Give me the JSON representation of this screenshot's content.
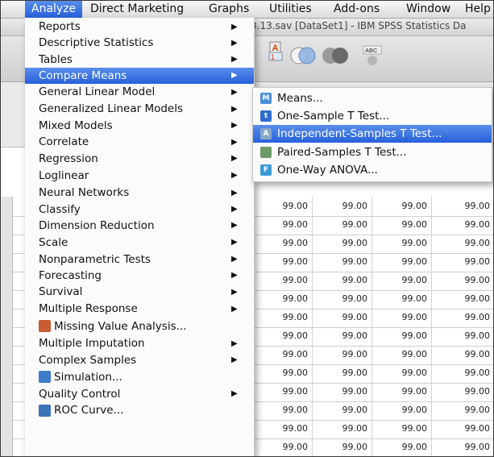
{
  "menubar": {
    "items": [
      "Analyze",
      "Direct Marketing",
      "Graphs",
      "Utilities",
      "Add-ons",
      "Window",
      "Help"
    ],
    "active": "Analyze"
  },
  "window": {
    "title": "3.13.sav [DataSet1] - IBM SPSS Statistics Da"
  },
  "analyze_menu": {
    "items": [
      {
        "label": "Reports",
        "has_submenu": true
      },
      {
        "label": "Descriptive Statistics",
        "has_submenu": true
      },
      {
        "label": "Tables",
        "has_submenu": true
      },
      {
        "label": "Compare Means",
        "has_submenu": true,
        "active": true
      },
      {
        "label": "General Linear Model",
        "has_submenu": true
      },
      {
        "label": "Generalized Linear Models",
        "has_submenu": true
      },
      {
        "label": "Mixed Models",
        "has_submenu": true
      },
      {
        "label": "Correlate",
        "has_submenu": true
      },
      {
        "label": "Regression",
        "has_submenu": true
      },
      {
        "label": "Loglinear",
        "has_submenu": true
      },
      {
        "label": "Neural Networks",
        "has_submenu": true
      },
      {
        "label": "Classify",
        "has_submenu": true
      },
      {
        "label": "Dimension Reduction",
        "has_submenu": true
      },
      {
        "label": "Scale",
        "has_submenu": true
      },
      {
        "label": "Nonparametric Tests",
        "has_submenu": true
      },
      {
        "label": "Forecasting",
        "has_submenu": true
      },
      {
        "label": "Survival",
        "has_submenu": true
      },
      {
        "label": "Multiple Response",
        "has_submenu": true
      },
      {
        "label": "Missing Value Analysis...",
        "icon": "missing-value-icon"
      },
      {
        "label": "Multiple Imputation",
        "has_submenu": true
      },
      {
        "label": "Complex Samples",
        "has_submenu": true
      },
      {
        "label": "Simulation...",
        "icon": "simulation-icon"
      },
      {
        "label": "Quality Control",
        "has_submenu": true
      },
      {
        "label": "ROC Curve...",
        "icon": "roc-curve-icon"
      }
    ],
    "arrow_glyph": "▶"
  },
  "compare_means_submenu": {
    "items": [
      {
        "label": "Means...",
        "icon": "means-icon",
        "glyph": "M",
        "color": "#4a90d9"
      },
      {
        "label": "One-Sample T Test...",
        "icon": "one-sample-t-icon",
        "glyph": "t",
        "color": "#2f6fcf"
      },
      {
        "label": "Independent-Samples T Test...",
        "icon": "independent-t-icon",
        "glyph": "A",
        "color": "#8aa8c8",
        "active": true
      },
      {
        "label": "Paired-Samples T Test...",
        "icon": "paired-t-icon",
        "glyph": "",
        "color": "#6c9a6a"
      },
      {
        "label": "One-Way ANOVA...",
        "icon": "anova-icon",
        "glyph": "F",
        "color": "#3a9bd6"
      }
    ]
  },
  "data_grid": {
    "value": "99.00",
    "rows": 15,
    "columns": 4
  },
  "colors": {
    "highlight": "#2f6be0",
    "menu_bg": "#fbfbfb"
  }
}
